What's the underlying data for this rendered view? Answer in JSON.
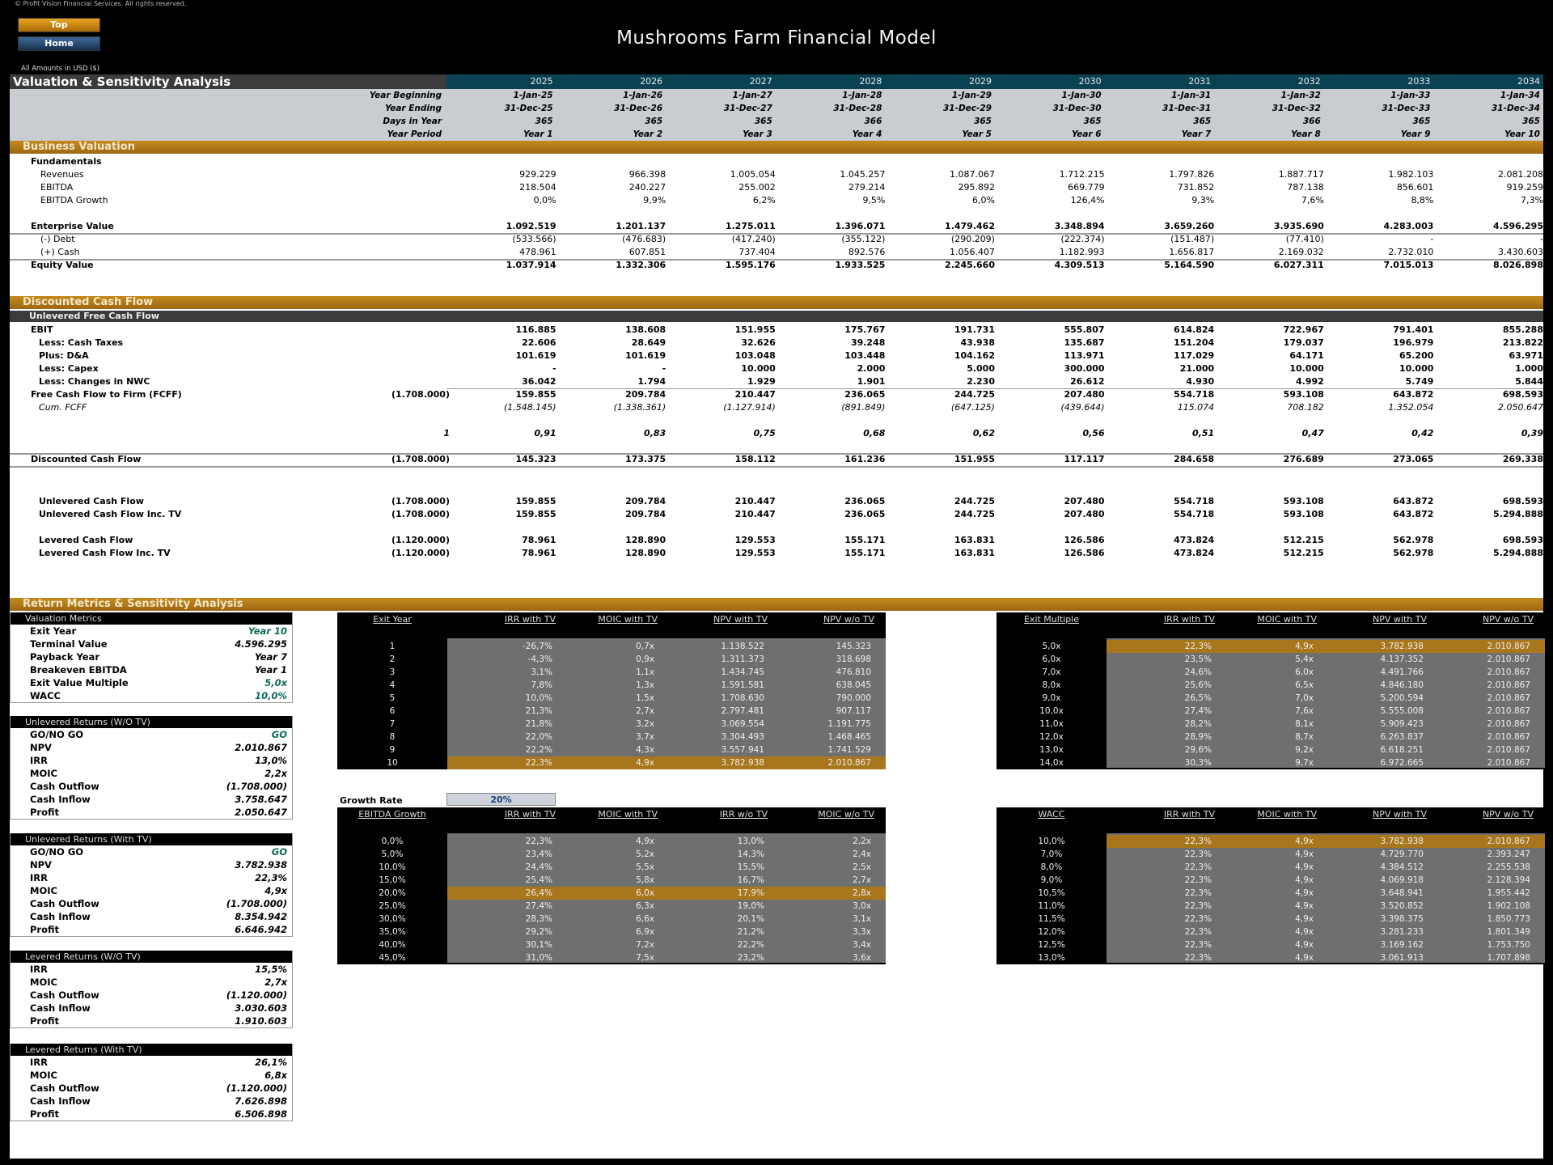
{
  "copyright": "© Profit Vision Financial Services. All rights reserved.",
  "nav": {
    "top": "Top",
    "home": "Home"
  },
  "title": "Mushrooms Farm Financial Model",
  "amounts_note": "All Amounts in  USD ($)",
  "section_title": "Valuation & Sensitivity Analysis",
  "years": [
    "2025",
    "2026",
    "2027",
    "2028",
    "2029",
    "2030",
    "2031",
    "2032",
    "2033",
    "2034"
  ],
  "timeline": {
    "labels": [
      "Year Beginning",
      "Year Ending",
      "Days in Year",
      "Year Period"
    ],
    "rows": [
      [
        "1-Jan-25",
        "1-Jan-26",
        "1-Jan-27",
        "1-Jan-28",
        "1-Jan-29",
        "1-Jan-30",
        "1-Jan-31",
        "1-Jan-32",
        "1-Jan-33",
        "1-Jan-34"
      ],
      [
        "31-Dec-25",
        "31-Dec-26",
        "31-Dec-27",
        "31-Dec-28",
        "31-Dec-29",
        "31-Dec-30",
        "31-Dec-31",
        "31-Dec-32",
        "31-Dec-33",
        "31-Dec-34"
      ],
      [
        "365",
        "365",
        "365",
        "366",
        "365",
        "365",
        "365",
        "366",
        "365",
        "365"
      ],
      [
        "Year 1",
        "Year 2",
        "Year 3",
        "Year 4",
        "Year 5",
        "Year 6",
        "Year 7",
        "Year 8",
        "Year 9",
        "Year 10"
      ]
    ]
  },
  "business_valuation": {
    "title": "Business Valuation",
    "fundamentals_label": "Fundamentals",
    "rows": [
      {
        "label": "Revenues",
        "values": [
          "929.229",
          "966.398",
          "1.005.054",
          "1.045.257",
          "1.087.067",
          "1.712.215",
          "1.797.826",
          "1.887.717",
          "1.982.103",
          "2.081.208"
        ]
      },
      {
        "label": "EBITDA",
        "values": [
          "218.504",
          "240.227",
          "255.002",
          "279.214",
          "295.892",
          "669.779",
          "731.852",
          "787.138",
          "856.601",
          "919.259"
        ]
      },
      {
        "label": "EBITDA Growth",
        "values": [
          "0,0%",
          "9,9%",
          "6,2%",
          "9,5%",
          "6,0%",
          "126,4%",
          "9,3%",
          "7,6%",
          "8,8%",
          "7,3%"
        ]
      },
      {
        "label": "Enterprise Value",
        "values": [
          "1.092.519",
          "1.201.137",
          "1.275.011",
          "1.396.071",
          "1.479.462",
          "3.348.894",
          "3.659.260",
          "3.935.690",
          "4.283.003",
          "4.596.295"
        ]
      },
      {
        "label": "(-) Debt",
        "values": [
          "(533.566)",
          "(476.683)",
          "(417.240)",
          "(355.122)",
          "(290.209)",
          "(222.374)",
          "(151.487)",
          "(77.410)",
          "-",
          "-"
        ]
      },
      {
        "label": "(+) Cash",
        "values": [
          "478.961",
          "607.851",
          "737.404",
          "892.576",
          "1.056.407",
          "1.182.993",
          "1.656.817",
          "2.169.032",
          "2.732.010",
          "3.430.603"
        ]
      },
      {
        "label": "Equity Value",
        "values": [
          "1.037.914",
          "1.332.306",
          "1.595.176",
          "1.933.525",
          "2.245.660",
          "4.309.513",
          "5.164.590",
          "6.027.311",
          "7.015.013",
          "8.026.898"
        ]
      }
    ]
  },
  "dcf": {
    "title": "Discounted Cash Flow",
    "subtitle": "Unlevered Free Cash Flow",
    "rows": [
      {
        "label": "EBIT",
        "pre": "",
        "values": [
          "116.885",
          "138.608",
          "151.955",
          "175.767",
          "191.731",
          "555.807",
          "614.824",
          "722.967",
          "791.401",
          "855.288"
        ]
      },
      {
        "label": "Less: Cash Taxes",
        "pre": "",
        "values": [
          "22.606",
          "28.649",
          "32.626",
          "39.248",
          "43.938",
          "135.687",
          "151.204",
          "179.037",
          "196.979",
          "213.822"
        ]
      },
      {
        "label": "Plus: D&A",
        "pre": "",
        "values": [
          "101.619",
          "101.619",
          "103.048",
          "103.448",
          "104.162",
          "113.971",
          "117.029",
          "64.171",
          "65.200",
          "63.971"
        ]
      },
      {
        "label": "Less: Capex",
        "pre": "",
        "values": [
          "-",
          "-",
          "10.000",
          "2.000",
          "5.000",
          "300.000",
          "21.000",
          "10.000",
          "10.000",
          "1.000"
        ]
      },
      {
        "label": "Less: Changes in NWC",
        "pre": "",
        "values": [
          "36.042",
          "1.794",
          "1.929",
          "1.901",
          "2.230",
          "26.612",
          "4.930",
          "4.992",
          "5.749",
          "5.844"
        ]
      },
      {
        "label": "Free Cash Flow to Firm (FCFF)",
        "pre": "(1.708.000)",
        "values": [
          "159.855",
          "209.784",
          "210.447",
          "236.065",
          "244.725",
          "207.480",
          "554.718",
          "593.108",
          "643.872",
          "698.593"
        ]
      },
      {
        "label": "Cum. FCFF",
        "pre": "",
        "values": [
          "(1.548.145)",
          "(1.338.361)",
          "(1.127.914)",
          "(891.849)",
          "(647.125)",
          "(439.644)",
          "115.074",
          "708.182",
          "1.352.054",
          "2.050.647"
        ]
      },
      {
        "label": "",
        "pre": "1",
        "values": [
          "0,91",
          "0,83",
          "0,75",
          "0,68",
          "0,62",
          "0,56",
          "0,51",
          "0,47",
          "0,42",
          "0,39"
        ]
      },
      {
        "label": "Discounted Cash Flow",
        "pre": "(1.708.000)",
        "values": [
          "145.323",
          "173.375",
          "158.112",
          "161.236",
          "151.955",
          "117.117",
          "284.658",
          "276.689",
          "273.065",
          "269.338"
        ]
      }
    ],
    "cash_flows": [
      {
        "label": "Unlevered Cash Flow",
        "pre": "(1.708.000)",
        "values": [
          "159.855",
          "209.784",
          "210.447",
          "236.065",
          "244.725",
          "207.480",
          "554.718",
          "593.108",
          "643.872",
          "698.593"
        ]
      },
      {
        "label": "Unlevered Cash Flow Inc. TV",
        "pre": "(1.708.000)",
        "values": [
          "159.855",
          "209.784",
          "210.447",
          "236.065",
          "244.725",
          "207.480",
          "554.718",
          "593.108",
          "643.872",
          "5.294.888"
        ]
      },
      {
        "label": "Levered Cash Flow",
        "pre": "(1.120.000)",
        "values": [
          "78.961",
          "128.890",
          "129.553",
          "155.171",
          "163.831",
          "126.586",
          "473.824",
          "512.215",
          "562.978",
          "698.593"
        ]
      },
      {
        "label": "Levered Cash Flow Inc. TV",
        "pre": "(1.120.000)",
        "values": [
          "78.961",
          "128.890",
          "129.553",
          "155.171",
          "163.831",
          "126.586",
          "473.824",
          "512.215",
          "562.978",
          "5.294.888"
        ]
      }
    ]
  },
  "returns": {
    "title": "Return Metrics & Sensitivity Analysis",
    "boxes": [
      {
        "title": "Valuation Metrics",
        "rows": [
          {
            "label": "Exit Year",
            "value": "Year 10",
            "accent": true
          },
          {
            "label": "Terminal Value",
            "value": "4.596.295"
          },
          {
            "label": "Payback Year",
            "value": "Year 7"
          },
          {
            "label": "Breakeven EBITDA",
            "value": "Year 1"
          },
          {
            "label": "Exit Value Multiple",
            "value": "5,0x",
            "accent": true
          },
          {
            "label": "WACC",
            "value": "10,0%",
            "accent": true
          }
        ]
      },
      {
        "title": "Unlevered Returns (W/O TV)",
        "rows": [
          {
            "label": "GO/NO GO",
            "value": "GO",
            "accent": true
          },
          {
            "label": "NPV",
            "value": "2.010.867"
          },
          {
            "label": "IRR",
            "value": "13,0%"
          },
          {
            "label": "MOIC",
            "value": "2,2x"
          },
          {
            "label": "Cash Outflow",
            "value": "(1.708.000)"
          },
          {
            "label": "Cash Inflow",
            "value": "3.758.647"
          },
          {
            "label": "Profit",
            "value": "2.050.647"
          }
        ]
      },
      {
        "title": "Unlevered Returns (With TV)",
        "rows": [
          {
            "label": "GO/NO GO",
            "value": "GO",
            "accent": true
          },
          {
            "label": "NPV",
            "value": "3.782.938"
          },
          {
            "label": "IRR",
            "value": "22,3%"
          },
          {
            "label": "MOIC",
            "value": "4,9x"
          },
          {
            "label": "Cash Outflow",
            "value": "(1.708.000)"
          },
          {
            "label": "Cash Inflow",
            "value": "8.354.942"
          },
          {
            "label": "Profit",
            "value": "6.646.942"
          }
        ]
      },
      {
        "title": "Levered Returns (W/O TV)",
        "rows": [
          {
            "label": "IRR",
            "value": "15,5%"
          },
          {
            "label": "MOIC",
            "value": "2,7x"
          },
          {
            "label": "Cash Outflow",
            "value": "(1.120.000)"
          },
          {
            "label": "Cash Inflow",
            "value": "3.030.603"
          },
          {
            "label": "Profit",
            "value": "1.910.603"
          }
        ]
      },
      {
        "title": "Levered Returns (With TV)",
        "rows": [
          {
            "label": "IRR",
            "value": "26,1%"
          },
          {
            "label": "MOIC",
            "value": "6,8x"
          },
          {
            "label": "Cash Outflow",
            "value": "(1.120.000)"
          },
          {
            "label": "Cash Inflow",
            "value": "7.626.898"
          },
          {
            "label": "Profit",
            "value": "6.506.898"
          }
        ]
      }
    ],
    "growth_rate": {
      "label": "Growth Rate",
      "value": "20%"
    },
    "tables": [
      {
        "headers": [
          "Exit Year",
          "IRR with TV",
          "MOIC with TV",
          "NPV with TV",
          "NPV w/o TV"
        ],
        "highlight": 9,
        "rows": [
          [
            "1",
            "-26,7%",
            "0,7x",
            "1.138.522",
            "145.323"
          ],
          [
            "2",
            "-4,3%",
            "0,9x",
            "1.311.373",
            "318.698"
          ],
          [
            "3",
            "3,1%",
            "1,1x",
            "1.434.745",
            "476.810"
          ],
          [
            "4",
            "7,8%",
            "1,3x",
            "1.591.581",
            "638.045"
          ],
          [
            "5",
            "10,0%",
            "1,5x",
            "1.708.630",
            "790.000"
          ],
          [
            "6",
            "21,3%",
            "2,7x",
            "2.797.481",
            "907.117"
          ],
          [
            "7",
            "21,8%",
            "3,2x",
            "3.069.554",
            "1.191.775"
          ],
          [
            "8",
            "22,0%",
            "3,7x",
            "3.304.493",
            "1.468.465"
          ],
          [
            "9",
            "22,2%",
            "4,3x",
            "3.557.941",
            "1.741.529"
          ],
          [
            "10",
            "22,3%",
            "4,9x",
            "3.782.938",
            "2.010.867"
          ]
        ]
      },
      {
        "headers": [
          "Exit Multiple",
          "IRR with TV",
          "MOIC with TV",
          "NPV with TV",
          "NPV w/o TV"
        ],
        "highlight": 0,
        "rows": [
          [
            "5,0x",
            "22,3%",
            "4,9x",
            "3.782.938",
            "2.010.867"
          ],
          [
            "6,0x",
            "23,5%",
            "5,4x",
            "4.137.352",
            "2.010.867"
          ],
          [
            "7,0x",
            "24,6%",
            "6,0x",
            "4.491.766",
            "2.010.867"
          ],
          [
            "8,0x",
            "25,6%",
            "6,5x",
            "4.846.180",
            "2.010.867"
          ],
          [
            "9,0x",
            "26,5%",
            "7,0x",
            "5.200.594",
            "2.010.867"
          ],
          [
            "10,0x",
            "27,4%",
            "7,6x",
            "5.555.008",
            "2.010.867"
          ],
          [
            "11,0x",
            "28,2%",
            "8,1x",
            "5.909.423",
            "2.010.867"
          ],
          [
            "12,0x",
            "28,9%",
            "8,7x",
            "6.263.837",
            "2.010.867"
          ],
          [
            "13,0x",
            "29,6%",
            "9,2x",
            "6.618.251",
            "2.010.867"
          ],
          [
            "14,0x",
            "30,3%",
            "9,7x",
            "6.972.665",
            "2.010.867"
          ]
        ]
      },
      {
        "headers": [
          "EBITDA Growth",
          "IRR with TV",
          "MOIC with TV",
          "IRR w/o TV",
          "MOIC w/o TV"
        ],
        "highlight": 4,
        "rows": [
          [
            "0,0%",
            "22,3%",
            "4,9x",
            "13,0%",
            "2,2x"
          ],
          [
            "5,0%",
            "23,4%",
            "5,2x",
            "14,3%",
            "2,4x"
          ],
          [
            "10,0%",
            "24,4%",
            "5,5x",
            "15,5%",
            "2,5x"
          ],
          [
            "15,0%",
            "25,4%",
            "5,8x",
            "16,7%",
            "2,7x"
          ],
          [
            "20,0%",
            "26,4%",
            "6,0x",
            "17,9%",
            "2,8x"
          ],
          [
            "25,0%",
            "27,4%",
            "6,3x",
            "19,0%",
            "3,0x"
          ],
          [
            "30,0%",
            "28,3%",
            "6,6x",
            "20,1%",
            "3,1x"
          ],
          [
            "35,0%",
            "29,2%",
            "6,9x",
            "21,2%",
            "3,3x"
          ],
          [
            "40,0%",
            "30,1%",
            "7,2x",
            "22,2%",
            "3,4x"
          ],
          [
            "45,0%",
            "31,0%",
            "7,5x",
            "23,2%",
            "3,6x"
          ]
        ]
      },
      {
        "headers": [
          "WACC",
          "IRR with TV",
          "MOIC with TV",
          "NPV with TV",
          "NPV w/o TV"
        ],
        "highlight": 0,
        "rows": [
          [
            "10,0%",
            "22,3%",
            "4,9x",
            "3.782.938",
            "2.010.867"
          ],
          [
            "7,0%",
            "22,3%",
            "4,9x",
            "4.729.770",
            "2.393.247"
          ],
          [
            "8,0%",
            "22,3%",
            "4,9x",
            "4.384.512",
            "2.255.538"
          ],
          [
            "9,0%",
            "22,3%",
            "4,9x",
            "4.069.918",
            "2.128.394"
          ],
          [
            "10,5%",
            "22,3%",
            "4,9x",
            "3.648.941",
            "1.955.442"
          ],
          [
            "11,0%",
            "22,3%",
            "4,9x",
            "3.520.852",
            "1.902.108"
          ],
          [
            "11,5%",
            "22,3%",
            "4,9x",
            "3.398.375",
            "1.850.773"
          ],
          [
            "12,0%",
            "22,3%",
            "4,9x",
            "3.281.233",
            "1.801.349"
          ],
          [
            "12,5%",
            "22,3%",
            "4,9x",
            "3.169.162",
            "1.753.750"
          ],
          [
            "13,0%",
            "22,3%",
            "4,9x",
            "3.061.913",
            "1.707.898"
          ]
        ]
      }
    ]
  }
}
